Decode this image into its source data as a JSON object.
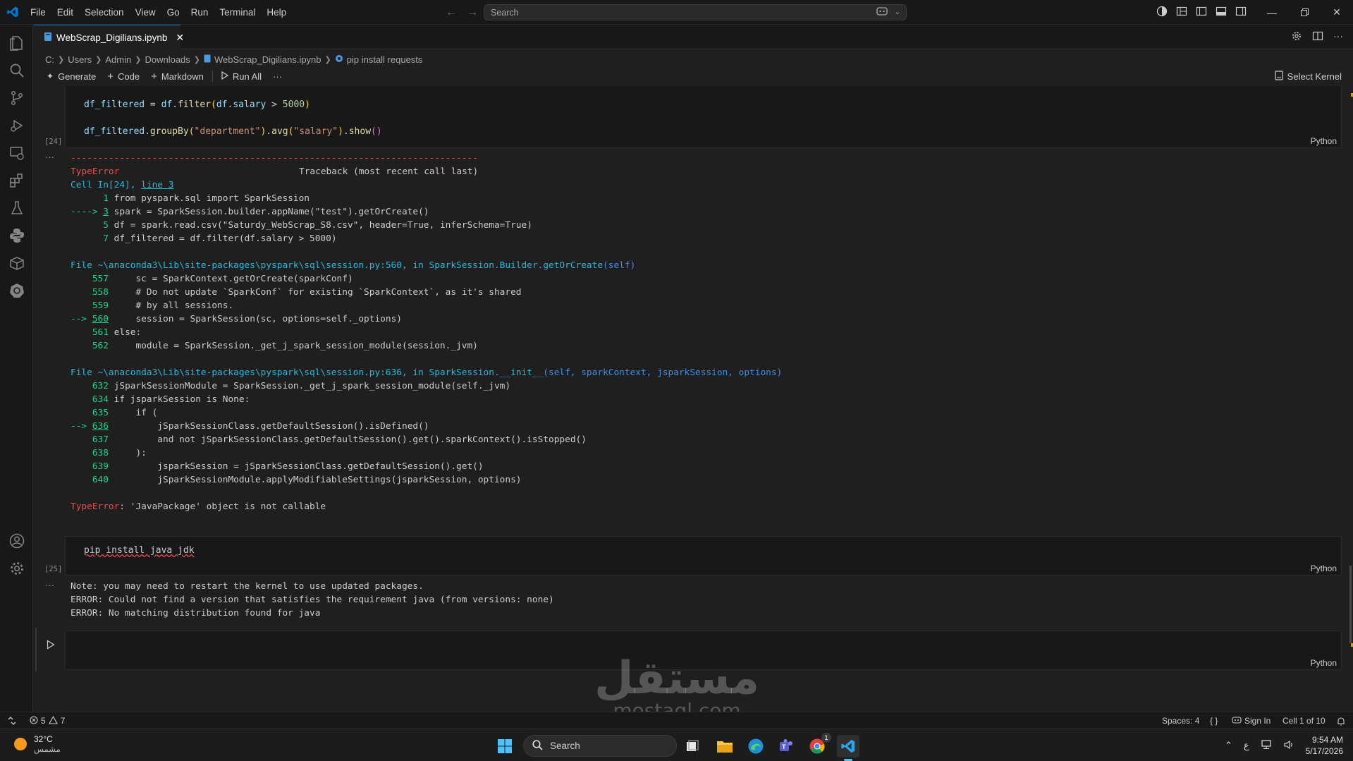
{
  "menu": [
    "File",
    "Edit",
    "Selection",
    "View",
    "Go",
    "Run",
    "Terminal",
    "Help"
  ],
  "search": {
    "placeholder": "Search"
  },
  "tab": {
    "title": "WebScrap_Digilians.ipynb"
  },
  "breadcrumb": [
    "C:",
    "Users",
    "Admin",
    "Downloads",
    "WebScrap_Digilians.ipynb",
    "pip install requests"
  ],
  "toolbar": {
    "generate": "Generate",
    "code": "Code",
    "markdown": "Markdown",
    "run_all": "Run All",
    "more": "···",
    "select_kernel": "Select Kernel"
  },
  "cells": {
    "cell24": {
      "exec_count": "[24]",
      "language": "Python",
      "code": [
        "df_filtered = df.filter(df.salary > 5000)",
        "df_filtered.groupBy(\"department\").avg(\"salary\").show()"
      ],
      "output": {
        "dash_line": "---------------------------------------------------------------------------",
        "error_type": "TypeError",
        "traceback_header": "Traceback (most recent call last)",
        "cell_ref": "Cell In[24], ",
        "cell_ref_line": "line 3",
        "frame1": [
          {
            "marker": "      ",
            "num": "1",
            "code": " from pyspark.sql import SparkSession"
          },
          {
            "marker": "----> ",
            "num": "3",
            "code": " spark = SparkSession.builder.appName(\"test\").getOrCreate()"
          },
          {
            "marker": "      ",
            "num": "5",
            "code": " df = spark.read.csv(\"Saturdy_WebScrap_S8.csv\", header=True, inferSchema=True)"
          },
          {
            "marker": "      ",
            "num": "7",
            "code": " df_filtered = df.filter(df.salary > 5000)"
          }
        ],
        "file2_prefix": "File ~\\anaconda3\\Lib\\site-packages\\pyspark\\sql\\session.py:560, in ",
        "file2_func": "SparkSession.Builder.getOrCreate",
        "file2_args": "(self)",
        "frame2": [
          {
            "marker": "    ",
            "num": "557",
            "code": "     sc = SparkContext.getOrCreate(sparkConf)"
          },
          {
            "marker": "    ",
            "num": "558",
            "code": "     # Do not update `SparkConf` for existing `SparkContext`, as it's shared"
          },
          {
            "marker": "    ",
            "num": "559",
            "code": "     # by all sessions."
          },
          {
            "marker": "--> ",
            "num": "560",
            "code": "     session = SparkSession(sc, options=self._options)"
          },
          {
            "marker": "    ",
            "num": "561",
            "code": " else:"
          },
          {
            "marker": "    ",
            "num": "562",
            "code": "     module = SparkSession._get_j_spark_session_module(session._jvm)"
          }
        ],
        "file3_prefix": "File ~\\anaconda3\\Lib\\site-packages\\pyspark\\sql\\session.py:636, in ",
        "file3_func": "SparkSession.__init__",
        "file3_args": "(self, sparkContext, jsparkSession, options)",
        "frame3": [
          {
            "marker": "    ",
            "num": "632",
            "code": " jSparkSessionModule = SparkSession._get_j_spark_session_module(self._jvm)"
          },
          {
            "marker": "    ",
            "num": "634",
            "code": " if jsparkSession is None:"
          },
          {
            "marker": "    ",
            "num": "635",
            "code": "     if ("
          },
          {
            "marker": "--> ",
            "num": "636",
            "code": "         jSparkSessionClass.getDefaultSession().isDefined()"
          },
          {
            "marker": "    ",
            "num": "637",
            "code": "         and not jSparkSessionClass.getDefaultSession().get().sparkContext().isStopped()"
          },
          {
            "marker": "    ",
            "num": "638",
            "code": "     ):"
          },
          {
            "marker": "    ",
            "num": "639",
            "code": "         jsparkSession = jSparkSessionClass.getDefaultSession().get()"
          },
          {
            "marker": "    ",
            "num": "640",
            "code": "         jSparkSessionModule.applyModifiableSettings(jsparkSession, options)"
          }
        ],
        "final_error_type": "TypeError",
        "final_error_msg": ": 'JavaPackage' object is not callable"
      }
    },
    "cell25": {
      "exec_count": "[25]",
      "language": "Python",
      "code": "pip install java jdk",
      "output": [
        "Note: you may need to restart the kernel to use updated packages.",
        "ERROR: Could not find a version that satisfies the requirement java (from versions: none)",
        "ERROR: No matching distribution found for java"
      ]
    },
    "empty_cell": {
      "language": "Python"
    }
  },
  "statusbar": {
    "errors": "5",
    "warnings": "7",
    "spaces": "Spaces: 4",
    "braces": "{ }",
    "sign_in": "Sign In",
    "cell_pos": "Cell 1 of 10"
  },
  "taskbar": {
    "weather_temp": "32°C",
    "weather_desc": "مشمس",
    "search": "Search",
    "lang": "ع",
    "time": "9:54 AM",
    "date": "5/17/2026",
    "chrome_badge": "1"
  },
  "watermark": {
    "arabic": "مستقل",
    "latin": "mostaql.com"
  }
}
